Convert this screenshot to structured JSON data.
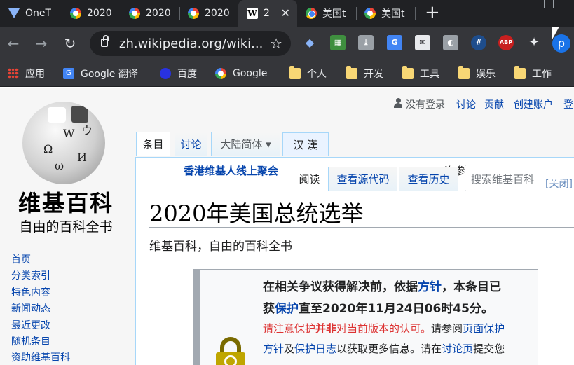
{
  "browser": {
    "tabs": [
      {
        "title": "OneT",
        "icon": "diamond-icon"
      },
      {
        "title": "2020",
        "icon": "google-icon"
      },
      {
        "title": "2020",
        "icon": "google-icon"
      },
      {
        "title": "2020",
        "icon": "google-icon"
      },
      {
        "title": "2",
        "icon": "wikipedia-icon",
        "close": "✕"
      },
      {
        "title": "美国t",
        "icon": "chrome-icon"
      },
      {
        "title": "美国t",
        "icon": "google-icon"
      }
    ],
    "new_tab": "+",
    "url": "zh.wikipedia.org/wiki...",
    "extensions": [
      {
        "label": "◆",
        "color": "#8ab4f8"
      },
      {
        "label": "▦",
        "color": "#3f8f3f"
      },
      {
        "label": "⤓",
        "color": "#9aa0a6"
      },
      {
        "label": "G",
        "color": "#4285f4"
      },
      {
        "label": "✉",
        "color": "#e8eaed"
      },
      {
        "label": "◐",
        "color": "#9aa0a6"
      },
      {
        "label": "#",
        "color": "#1e4d8c"
      },
      {
        "label": "ABP",
        "color": "#c81f1f"
      },
      {
        "label": "✦",
        "color": "#9aa0a6"
      }
    ],
    "avatar": "p",
    "bookmarks": [
      {
        "label": "应用"
      },
      {
        "label": "Google 翻译"
      },
      {
        "label": "百度"
      },
      {
        "label": "Google"
      },
      {
        "label": "个人"
      },
      {
        "label": "开发"
      },
      {
        "label": "工具"
      },
      {
        "label": "娱乐"
      },
      {
        "label": "工作"
      }
    ]
  },
  "wiki": {
    "logo_title": "维基百科",
    "logo_subtitle": "自由的百科全书",
    "sidebar": [
      "首页",
      "分类索引",
      "特色内容",
      "新闻动态",
      "最近更改",
      "随机条目",
      "资助维基百科"
    ],
    "personal": {
      "not_logged": "没有登录",
      "talk": "讨论",
      "contrib": "贡献",
      "create": "创建账户",
      "login": "登"
    },
    "tabs": {
      "article": "条目",
      "talk": "讨论",
      "variant": "大陆简体 ▾",
      "hanhan": "汉 漢",
      "read": "阅读",
      "source": "查看源代码",
      "history": "查看历史"
    },
    "banner": "香港维基人线上聚会",
    "banner_tail": "资参考。",
    "search_placeholder": "搜索维基百科",
    "close": "[关闭]",
    "title": "2020年美国总统选举",
    "tagline": "维基百科，自由的百科全书",
    "notice": {
      "l1a": "在相关争议获得解决前，依据",
      "l1b": "方针",
      "l1c": "，本条目已",
      "l2a": "获",
      "l2b": "保护",
      "l2c": "直至2020年11月24日06时45分。",
      "l3a": "请注意保护",
      "l3b": "并非",
      "l3c": "对当前版本的认可。",
      "l3d": "请参阅",
      "l3e": "页面保护",
      "l4a": "方针",
      "l4b": "及",
      "l4c": "保护日志",
      "l4d": "以获取更多信息。请在",
      "l4e": "讨论页",
      "l4f": "提交您"
    }
  }
}
